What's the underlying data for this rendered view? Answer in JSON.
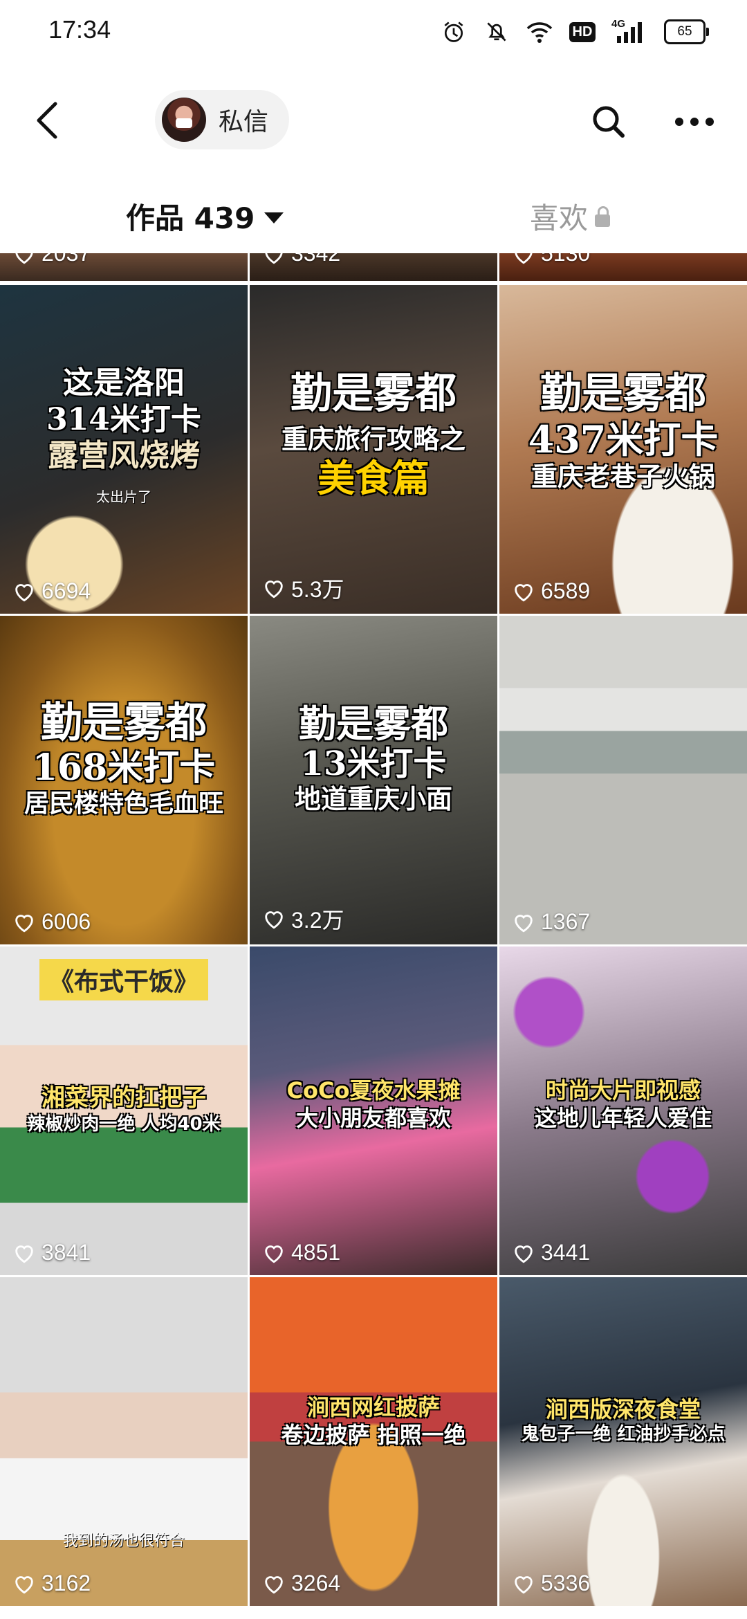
{
  "status_bar": {
    "time": "17:34",
    "hd": "HD",
    "network": "4G",
    "battery": "65"
  },
  "header": {
    "dm_label": "私信"
  },
  "tabs": {
    "works_label": "作品 439",
    "likes_label": "喜欢"
  },
  "colors": {
    "text_primary": "#111111",
    "tab_inactive": "#9a9a9a",
    "title_yellow": "#ffd200"
  },
  "partial_row": [
    {
      "likes": "2037"
    },
    {
      "likes": "3342"
    },
    {
      "likes": "5130"
    }
  ],
  "videos": [
    {
      "lines": [
        "这是洛阳",
        "314米打卡",
        "露营风烧烤"
      ],
      "note": "太出片了",
      "likes": "6694"
    },
    {
      "lines": [
        "勤是雾都",
        "重庆旅行攻略之",
        "美食篇"
      ],
      "likes": "5.3万"
    },
    {
      "lines": [
        "勤是雾都",
        "437米打卡",
        "重庆老巷子火锅"
      ],
      "likes": "6589"
    },
    {
      "lines": [
        "勤是雾都",
        "168米打卡",
        "居民楼特色毛血旺"
      ],
      "likes": "6006"
    },
    {
      "lines": [
        "勤是雾都",
        "13米打卡",
        "地道重庆小面"
      ],
      "likes": "3.2万"
    },
    {
      "lines": [],
      "likes": "1367"
    },
    {
      "lines": [
        "《布式干饭》",
        "湘菜界的扛把子",
        "辣椒炒肉一绝 人均40米"
      ],
      "likes": "3841"
    },
    {
      "lines": [
        "CoCo夏夜水果摊",
        "大小朋友都喜欢"
      ],
      "likes": "4851"
    },
    {
      "lines": [
        "时尚大片即视感",
        "这地儿年轻人爱住"
      ],
      "likes": "3441"
    },
    {
      "lines": [],
      "note": "我到的汤也很符合",
      "likes": "3162"
    },
    {
      "lines": [
        "涧西网红披萨",
        "卷边披萨 拍照一绝"
      ],
      "likes": "3264"
    },
    {
      "lines": [
        "涧西版深夜食堂",
        "鬼包子一绝 红油抄手必点"
      ],
      "likes": "5336"
    }
  ]
}
